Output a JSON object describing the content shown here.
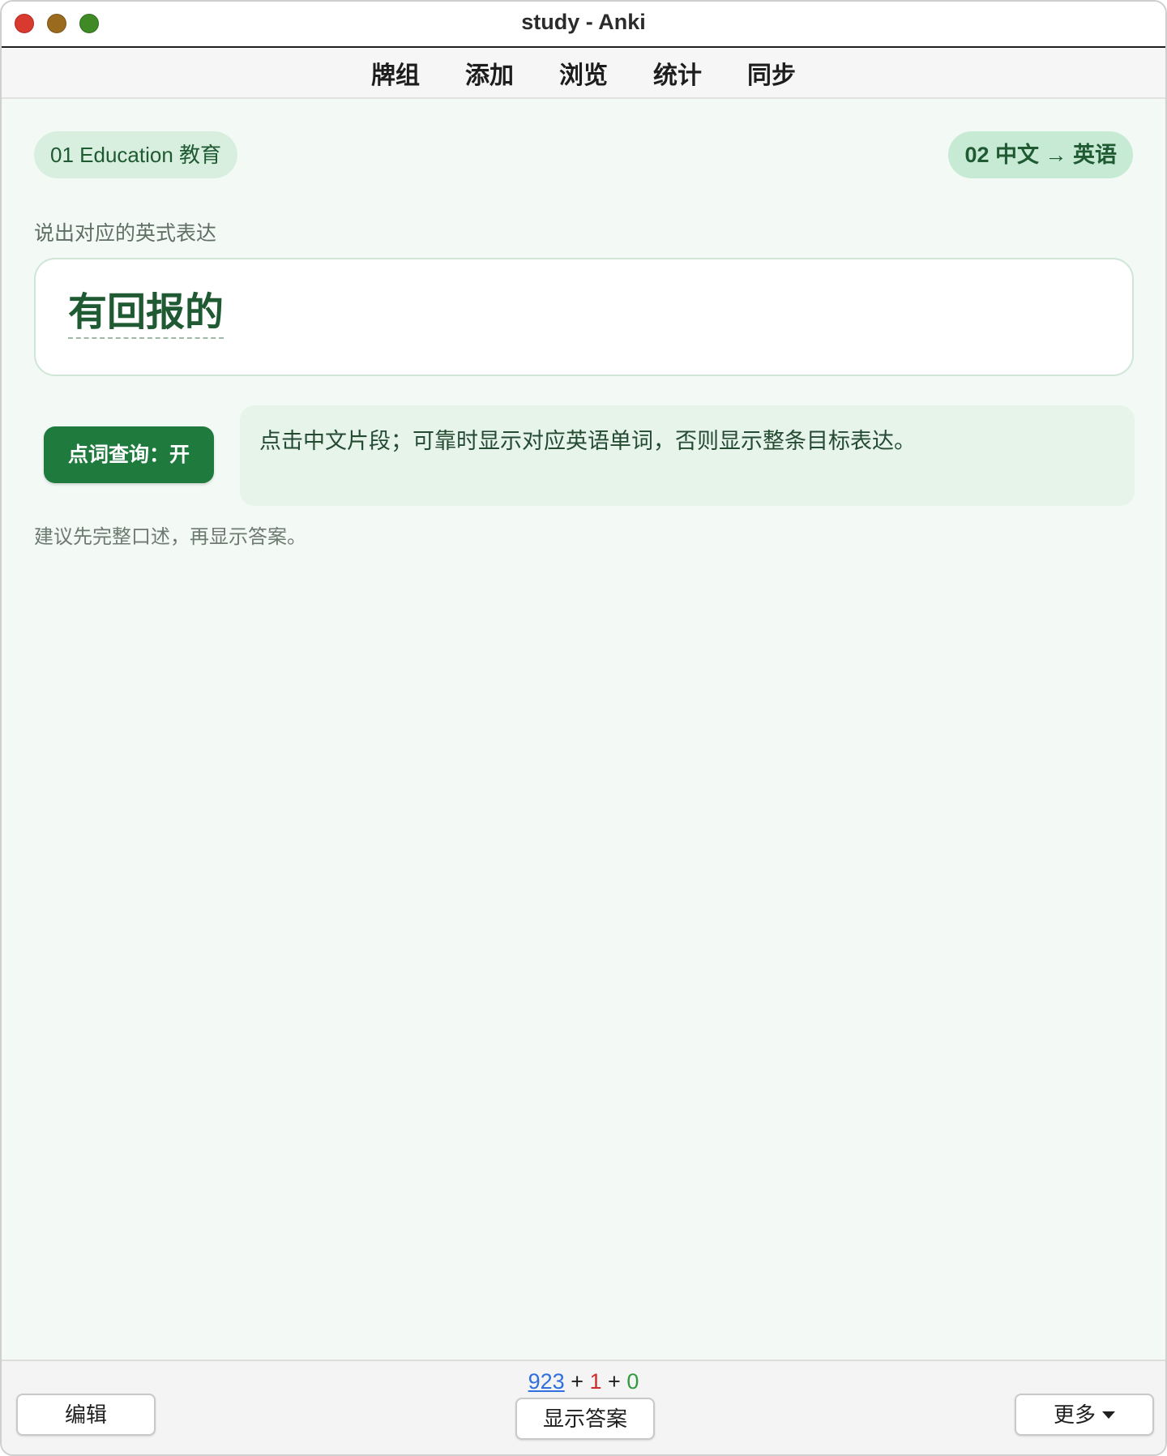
{
  "window": {
    "title": "study - Anki"
  },
  "nav": {
    "items": [
      "牌组",
      "添加",
      "浏览",
      "统计",
      "同步"
    ]
  },
  "card": {
    "deck_label": "01 Education 教育",
    "card_type_label": "02 中文 → 英语",
    "prompt": "说出对应的英式表达",
    "term": "有回报的",
    "lookup_button": "点词查询：开",
    "hint": "点击中文片段；可靠时显示对应英语单词，否则显示整条目标表达。",
    "advice": "建议先完整口述，再显示答案。"
  },
  "bottom": {
    "count_new": "923",
    "count_learn": "1",
    "count_review": "0",
    "plus": "+",
    "edit_button": "编辑",
    "show_answer_button": "显示答案",
    "more_button": "更多"
  },
  "colors": {
    "accent": "#1f7a3d",
    "background": "#f3f9f5",
    "count_new": "#2f6fde",
    "count_learn": "#d02b2b",
    "count_review": "#2f9a3e"
  },
  "icons": {
    "more_dropdown": "caret-down-icon"
  }
}
